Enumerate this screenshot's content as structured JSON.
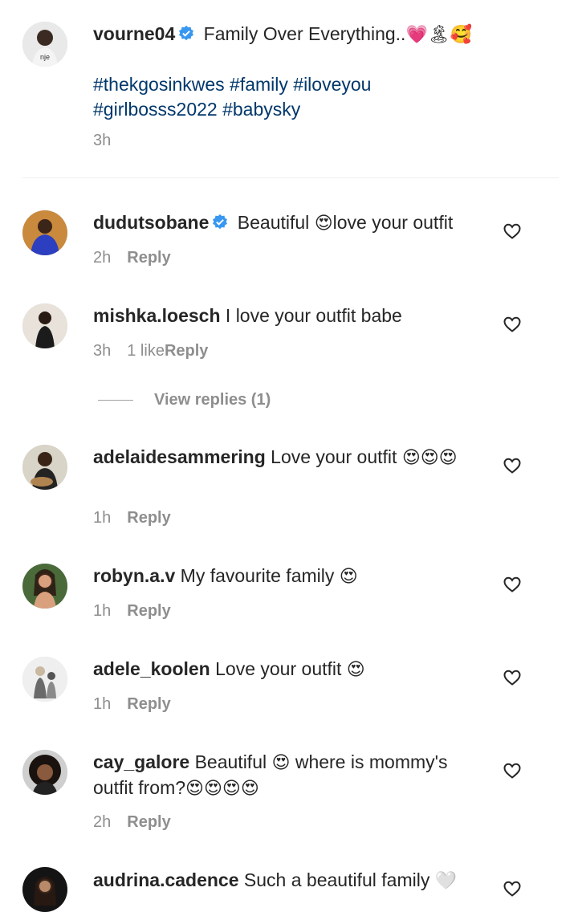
{
  "caption": {
    "username": "vourne04",
    "text": "Family Over Everything..",
    "emojis": "💗🏝🥰",
    "hashtags": "#thekgosinkwes #family #iloveyou #girlbosss2022 #babysky",
    "time": "3h",
    "avatar_text": "nje"
  },
  "comments": [
    {
      "username": "dudutsobane",
      "text": "Beautiful",
      "emoji_mid": "😍",
      "text_after": "love your outfit",
      "time": "2h",
      "likes": "",
      "reply": "Reply"
    },
    {
      "username": "mishka.loesch",
      "text": "I love your outfit babe",
      "time": "3h",
      "likes": "1 like",
      "reply": "Reply",
      "view_replies": "View replies (1)"
    },
    {
      "username": "adelaidesammering",
      "text": "Love your outfit",
      "emojis": "😍😍😍",
      "time": "1h",
      "reply": "Reply"
    },
    {
      "username": "robyn.a.v",
      "text": "My favourite family",
      "emojis": "😍",
      "time": "1h",
      "reply": "Reply"
    },
    {
      "username": "adele_koolen",
      "text": "Love your outfit",
      "emojis": "😍",
      "time": "1h",
      "reply": "Reply"
    },
    {
      "username": "cay_galore",
      "text": "Beautiful",
      "emoji_mid": "😍",
      "text_after": "where is mommy's outfit from?",
      "emojis": "😍😍😍😍",
      "time": "2h",
      "reply": "Reply"
    },
    {
      "username": "audrina.cadence",
      "text": "Such a beautiful family",
      "emojis": "🤍",
      "time": "",
      "reply": ""
    }
  ],
  "colors": {
    "text": "#262626",
    "meta": "#8e8e8e",
    "hashtag": "#00376b",
    "verified": "#3897f0"
  },
  "icons": {
    "verified": "verified-badge-icon",
    "heart": "heart-outline-icon"
  }
}
